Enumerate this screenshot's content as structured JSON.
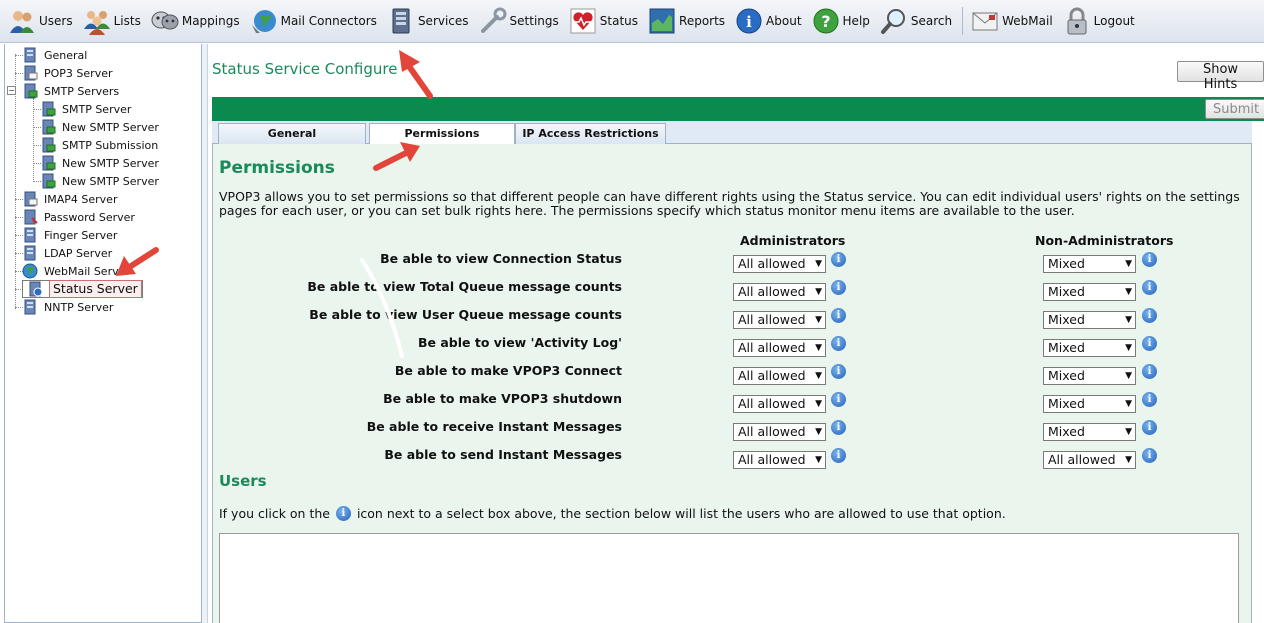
{
  "toolbar": {
    "items": [
      {
        "label": "Users",
        "icon": "users-icon"
      },
      {
        "label": "Lists",
        "icon": "lists-icon"
      },
      {
        "label": "Mappings",
        "icon": "mappings-icon"
      },
      {
        "label": "Mail Connectors",
        "icon": "mail-connectors-icon"
      },
      {
        "label": "Services",
        "icon": "services-icon"
      },
      {
        "label": "Settings",
        "icon": "settings-icon"
      },
      {
        "label": "Status",
        "icon": "status-icon"
      },
      {
        "label": "Reports",
        "icon": "reports-icon"
      },
      {
        "label": "About",
        "icon": "about-icon"
      },
      {
        "label": "Help",
        "icon": "help-icon"
      },
      {
        "label": "Search",
        "icon": "search-icon"
      },
      {
        "label": "WebMail",
        "icon": "webmail-icon"
      },
      {
        "label": "Logout",
        "icon": "logout-icon"
      }
    ]
  },
  "sidebar": {
    "items": [
      {
        "label": "General"
      },
      {
        "label": "POP3 Server"
      },
      {
        "label": "SMTP Servers"
      },
      {
        "label": "SMTP Server"
      },
      {
        "label": "New SMTP Server"
      },
      {
        "label": "SMTP Submission"
      },
      {
        "label": "New SMTP Server"
      },
      {
        "label": "New SMTP Server"
      },
      {
        "label": "IMAP4 Server"
      },
      {
        "label": "Password Server"
      },
      {
        "label": "Finger Server"
      },
      {
        "label": "LDAP Server"
      },
      {
        "label": "WebMail Server"
      },
      {
        "label": "Status Server"
      },
      {
        "label": "NNTP Server"
      }
    ],
    "selected": "Status Server"
  },
  "main": {
    "title": "Status Service Configure",
    "show_hints": "Show Hints",
    "submit": "Submit",
    "tabs": [
      {
        "label": "General"
      },
      {
        "label": "Permissions"
      },
      {
        "label": "IP Access Restrictions"
      }
    ],
    "active_tab": "Permissions",
    "heading": "Permissions",
    "description": "VPOP3 allows you to set permissions so that different people can have different rights using the Status service. You can edit individual users' rights on the settings pages for each user, or you can set bulk rights here. The permissions specify which status monitor menu items are available to the user.",
    "col_admin": "Administrators",
    "col_nonadmin": "Non-Administrators",
    "permissions": [
      {
        "label": "Be able to view Connection Status",
        "admin": "All allowed",
        "nonadmin": "Mixed"
      },
      {
        "label": "Be able to view Total Queue message counts",
        "admin": "All allowed",
        "nonadmin": "Mixed"
      },
      {
        "label": "Be able to view User Queue message counts",
        "admin": "All allowed",
        "nonadmin": "Mixed"
      },
      {
        "label": "Be able to view 'Activity Log'",
        "admin": "All allowed",
        "nonadmin": "Mixed"
      },
      {
        "label": "Be able to make VPOP3 Connect",
        "admin": "All allowed",
        "nonadmin": "Mixed"
      },
      {
        "label": "Be able to make VPOP3 shutdown",
        "admin": "All allowed",
        "nonadmin": "Mixed"
      },
      {
        "label": "Be able to receive Instant Messages",
        "admin": "All allowed",
        "nonadmin": "Mixed"
      },
      {
        "label": "Be able to send Instant Messages",
        "admin": "All allowed",
        "nonadmin": "All allowed"
      }
    ],
    "users_heading": "Users",
    "users_hint_before": "If you click on the",
    "users_hint_after": "icon next to a select box above, the section below will list the users who are allowed to use that option."
  },
  "colors": {
    "accent_green": "#0a8a4e",
    "heading_green": "#1a8a5a",
    "panel_bg": "#eaf5ee",
    "annotation_red": "#e2463a"
  }
}
